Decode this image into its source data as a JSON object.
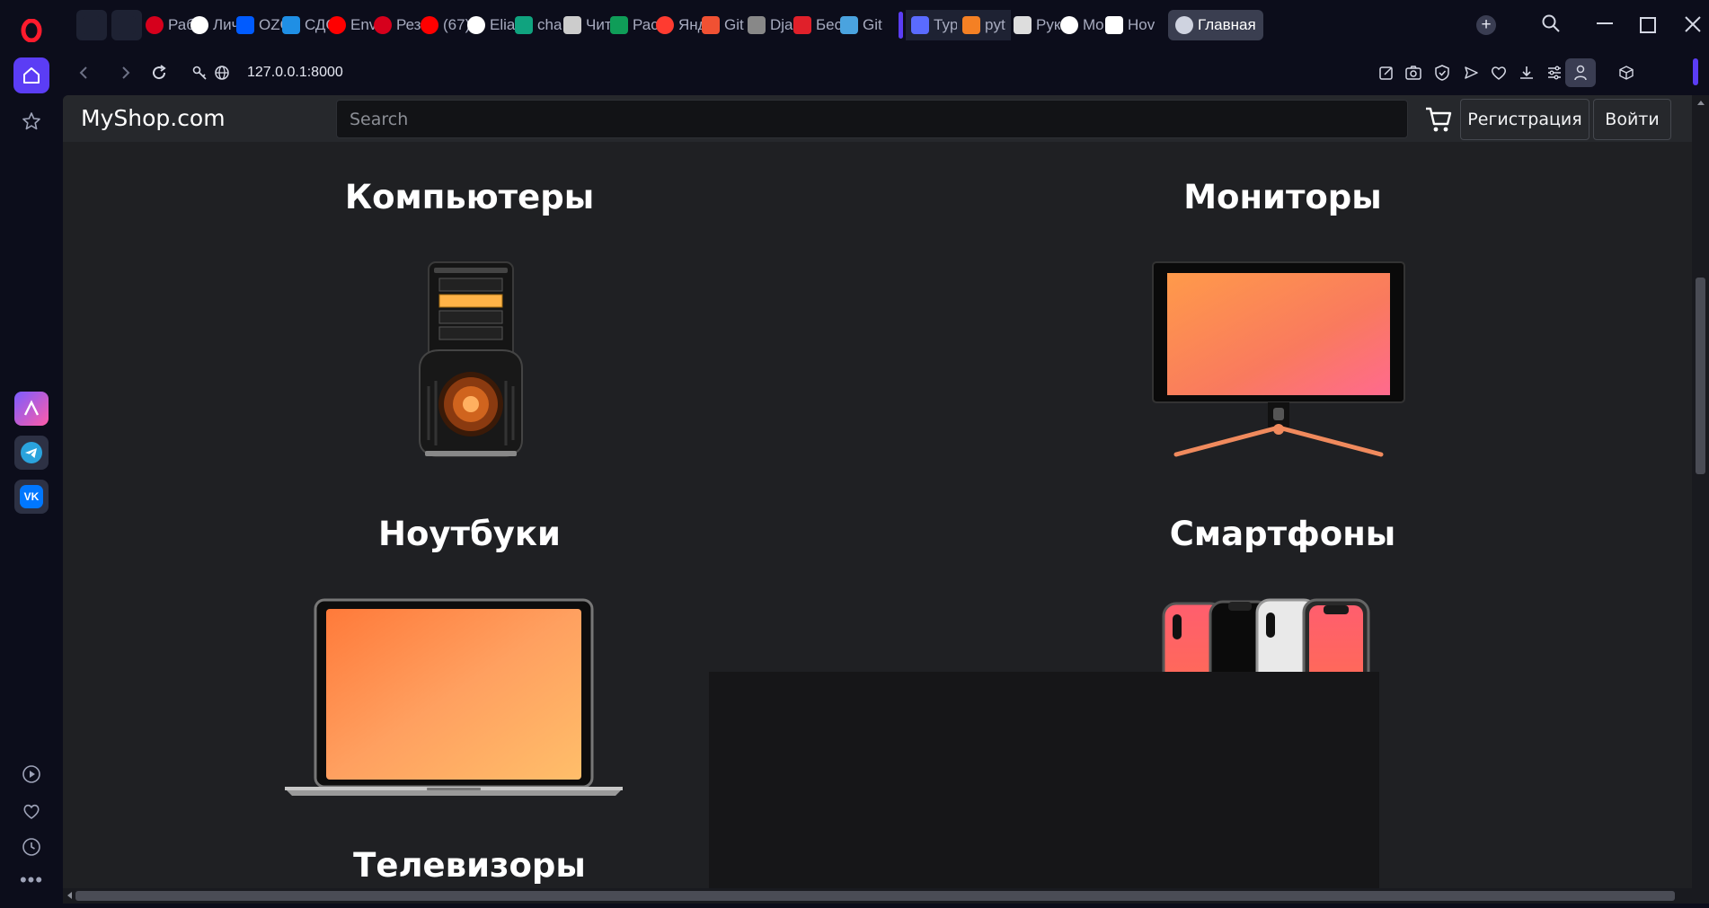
{
  "browser": {
    "tabs": [
      {
        "label": "",
        "icon": "gmail-icon",
        "color": "#1e2233"
      },
      {
        "label": "",
        "icon": "pause-icon",
        "color": "#1e2233"
      },
      {
        "label": "Раб",
        "icon": "hh-icon",
        "color": "#d6001c"
      },
      {
        "label": "Лич",
        "icon": "circle-logo-icon",
        "color": "#ffffff"
      },
      {
        "label": "OZO",
        "icon": "ozon-icon",
        "color": "#005bff"
      },
      {
        "label": "СДС",
        "icon": "t-logo-icon",
        "color": "#1f8fe5"
      },
      {
        "label": "Env",
        "icon": "youtube-icon",
        "color": "#ff0000"
      },
      {
        "label": "Рез",
        "icon": "hh-icon",
        "color": "#d6001c"
      },
      {
        "label": "(67)",
        "icon": "youtube-icon",
        "color": "#ff0000"
      },
      {
        "label": "Elia",
        "icon": "github-icon",
        "color": "#ffffff"
      },
      {
        "label": "cha",
        "icon": "chatgpt-icon",
        "color": "#10a37f"
      },
      {
        "label": "Чит",
        "icon": "book-icon",
        "color": "#cccccc"
      },
      {
        "label": "Рас",
        "icon": "sheet-plus-icon",
        "color": "#0f9d58"
      },
      {
        "label": "Янд",
        "icon": "map-pin-icon",
        "color": "#ff3b30"
      },
      {
        "label": "Git",
        "icon": "git-icon",
        "color": "#f05133"
      },
      {
        "label": "Dja",
        "icon": "mail-m-icon",
        "color": "#888888"
      },
      {
        "label": "Бес",
        "icon": "chat-square-icon",
        "color": "#e0202a"
      },
      {
        "label": "Git",
        "icon": "cloud-git-icon",
        "color": "#4aa3df"
      },
      {
        "label": "Typ",
        "icon": "people-icon",
        "color": "#5a6bff"
      },
      {
        "label": "pyt",
        "icon": "stack-icon",
        "color": "#f48024"
      },
      {
        "label": "Рук",
        "icon": "m-italic-icon",
        "color": "#dddddd"
      },
      {
        "label": "Mo",
        "icon": "github-icon",
        "color": "#ffffff"
      },
      {
        "label": "Hov",
        "icon": "notion-icon",
        "color": "#ffffff"
      },
      {
        "label": "Главная",
        "icon": "globe-icon",
        "color": "#cfd3e0"
      }
    ],
    "url": "127.0.0.1:8000"
  },
  "site": {
    "brand": "MyShop.com",
    "search_placeholder": "Search",
    "register_label": "Регистрация",
    "login_label": "Войти"
  },
  "categories": [
    {
      "title": "Компьютеры",
      "image": "computer-tower-image"
    },
    {
      "title": "Мониторы",
      "image": "monitor-image"
    },
    {
      "title": "Ноутбуки",
      "image": "laptop-image"
    },
    {
      "title": "Смартфоны",
      "image": "smartphones-image"
    },
    {
      "title": "Телевизоры",
      "image": "tv-image"
    }
  ],
  "colors": {
    "page_bg": "#1f2023",
    "navbar_bg": "#26282c",
    "accent": "#5b3df5",
    "screen_gradient_start": "#ff8a3d",
    "screen_gradient_end": "#ff5c8a"
  }
}
